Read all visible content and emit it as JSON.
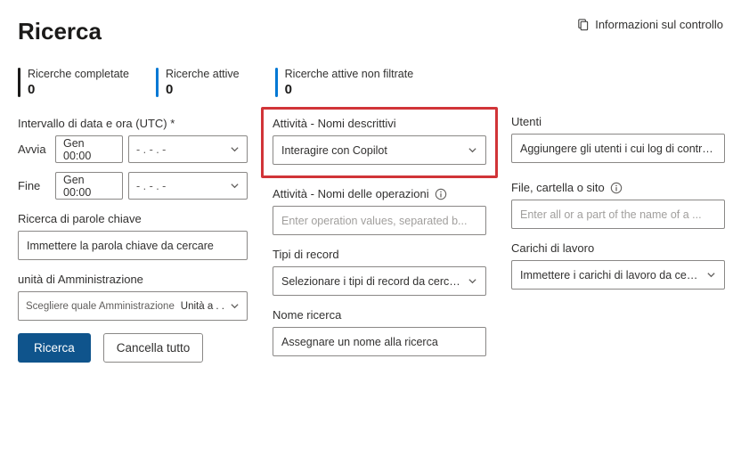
{
  "header": {
    "title": "Ricerca",
    "info_link": "Informazioni sul controllo"
  },
  "stats": {
    "completed": {
      "label": "Ricerche completate",
      "value": "0"
    },
    "active": {
      "label": "Ricerche attive",
      "value": "0"
    },
    "unfiltered": {
      "label": "Ricerche attive non filtrate",
      "value": "0"
    }
  },
  "left": {
    "datetime_label": "Intervallo di data e ora (UTC) *",
    "start_label": "Avvia",
    "end_label": "Fine",
    "date_value": "Gen 00:00",
    "time_placeholder": "- . - . -",
    "keyword_label": "Ricerca di parole chiave",
    "keyword_placeholder": "Immettere la parola chiave da cercare",
    "admin_label": "unità di Amministrazione",
    "admin_hint": "Scegliere quale Amministrazione",
    "admin_value": "Unità a . ."
  },
  "mid": {
    "activities_desc_label": "Attività - Nomi descrittivi",
    "activities_desc_value": "Interagire con Copilot",
    "operations_label": "Attività - Nomi delle operazioni",
    "operations_placeholder": "Enter operation values, separated b...",
    "record_types_label": "Tipi di record",
    "record_types_placeholder": "Selezionare i tipi di record da cercare",
    "search_name_label": "Nome ricerca",
    "search_name_placeholder": "Assegnare un nome alla ricerca"
  },
  "right": {
    "users_label": "Utenti",
    "users_placeholder": "Aggiungere gli utenti i cui log di controllo sono.",
    "file_label": "File, cartella o sito",
    "file_placeholder": "Enter all or a part of the name of a ...",
    "workloads_label": "Carichi di lavoro",
    "workloads_placeholder": "Immettere i carichi di lavoro da cercare"
  },
  "actions": {
    "search": "Ricerca",
    "clear": "Cancella tutto"
  }
}
